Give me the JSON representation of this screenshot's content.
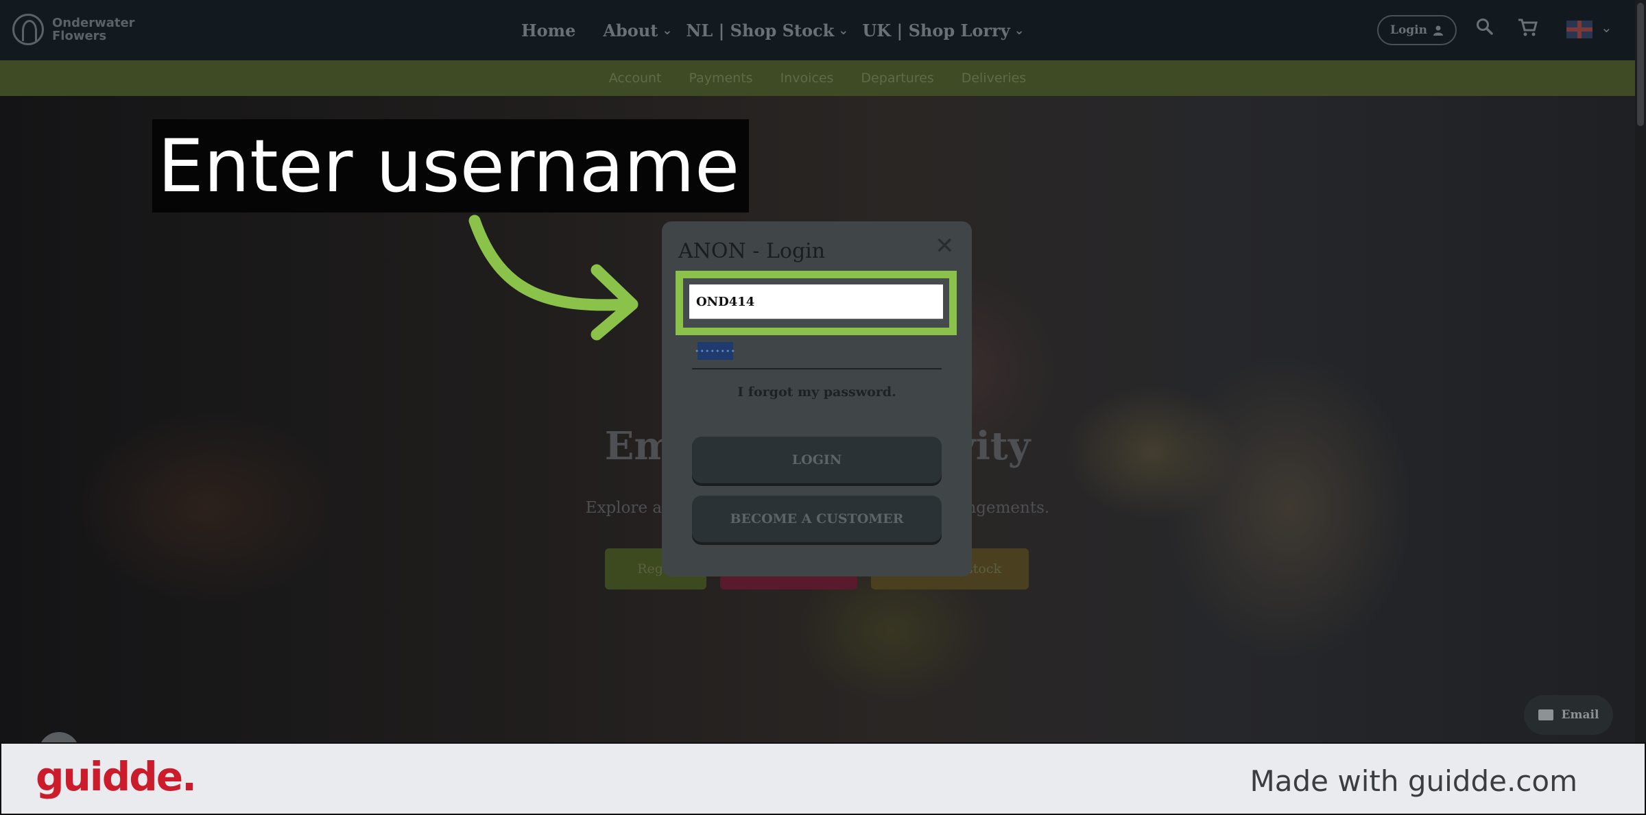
{
  "logo": {
    "line1": "Onderwater",
    "line2": "Flowers"
  },
  "nav": {
    "items": [
      {
        "label": "Home",
        "has_dropdown": false
      },
      {
        "label": "About",
        "has_dropdown": true
      },
      {
        "label": "NL | Shop Stock",
        "has_dropdown": true
      },
      {
        "label": "UK | Shop Lorry",
        "has_dropdown": true
      }
    ],
    "login_label": "Login",
    "icons": [
      "user-icon",
      "search-icon",
      "cart-icon",
      "uk-flag-icon",
      "chevron-down-icon"
    ]
  },
  "subnav": {
    "items": [
      "Account",
      "Payments",
      "Invoices",
      "Departures",
      "Deliveries"
    ]
  },
  "hero": {
    "title": "Empower ... eativity",
    "subtitle": "Explore a fabulous range of ... pes of floral arrangements.",
    "buttons": [
      "Regis",
      "",
      "stock"
    ]
  },
  "annotation": {
    "text": "Enter username"
  },
  "modal": {
    "title": "ANON - Login",
    "username_value": "OND414",
    "password_mask": "••••••••",
    "forgot_label": "I forgot my password.",
    "login_label": "LOGIN",
    "become_customer_label": "BECOME A CUSTOMER"
  },
  "email_widget": {
    "label": "Email"
  },
  "footer": {
    "brand": "guidde.",
    "made_with": "Made with guidde.com"
  },
  "colors": {
    "highlight": "#8bc34a",
    "brand_red": "#cc1b2b"
  }
}
